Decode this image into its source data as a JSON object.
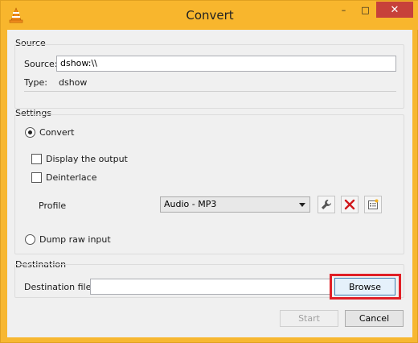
{
  "window": {
    "title": "Convert",
    "app_icon": "vlc-cone-icon",
    "controls": {
      "minimize": "–",
      "maximize": "□",
      "close": "✕"
    }
  },
  "source": {
    "group_title": "Source",
    "source_label": "Source:",
    "source_value": "dshow:\\\\",
    "type_label": "Type:",
    "type_value": "dshow"
  },
  "settings": {
    "group_title": "Settings",
    "convert_label": "Convert",
    "convert_selected": true,
    "display_output_label": "Display the output",
    "display_output_checked": false,
    "deinterlace_label": "Deinterlace",
    "deinterlace_checked": false,
    "profile_label": "Profile",
    "profile_value": "Audio - MP3",
    "profile_tools": [
      "wrench-icon",
      "delete-x-icon",
      "new-profile-icon"
    ],
    "dump_raw_label": "Dump raw input",
    "dump_raw_selected": false
  },
  "destination": {
    "group_title": "Destination",
    "file_label": "Destination file:",
    "file_value": "",
    "browse_label": "Browse"
  },
  "footer": {
    "start_label": "Start",
    "cancel_label": "Cancel"
  },
  "colors": {
    "titlebar": "#f8b62d",
    "close_button": "#c7413a",
    "highlight": "#e01f26",
    "dialog_bg": "#f0f0f0"
  }
}
